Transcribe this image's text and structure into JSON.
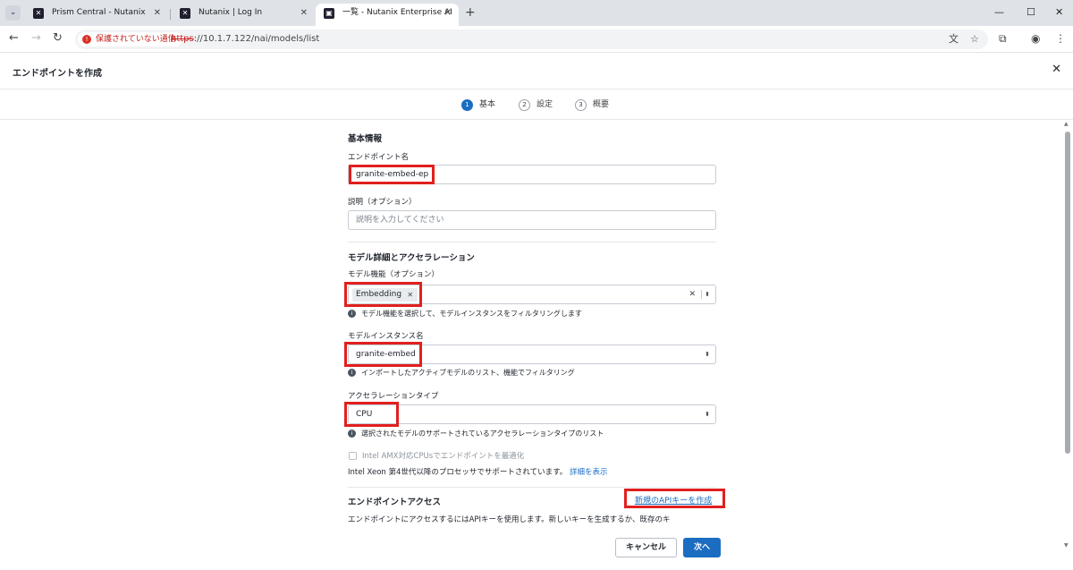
{
  "browser": {
    "tabs": [
      {
        "title": "Prism Central - Nutanix",
        "active": false
      },
      {
        "title": "Nutanix | Log In",
        "active": false
      },
      {
        "title": "一覧 - Nutanix Enterprise AI",
        "active": true
      }
    ],
    "security_chip": "保護されていない通信",
    "url_scheme": "https",
    "url_rest": "://10.1.7.122/nai/models/list"
  },
  "page": {
    "title": "エンドポイントを作成",
    "steps": [
      {
        "num": "1",
        "label": "基本"
      },
      {
        "num": "2",
        "label": "設定"
      },
      {
        "num": "3",
        "label": "概要"
      }
    ]
  },
  "form": {
    "basic_title": "基本情報",
    "endpoint_name_label": "エンドポイント名",
    "endpoint_name_value": "granite-embed-ep",
    "description_label": "説明（オプション）",
    "description_placeholder": "説明を入力してください",
    "model_section_title": "モデル詳細とアクセラレーション",
    "capability_label": "モデル機能（オプション）",
    "capability_tag": "Embedding",
    "capability_help": "モデル機能を選択して、モデルインスタンスをフィルタリングします",
    "instance_label": "モデルインスタンス名",
    "instance_value": "granite-embed",
    "instance_help": "インポートしたアクティブモデルのリスト、機能でフィルタリング",
    "accel_label": "アクセラレーションタイプ",
    "accel_value": "CPU",
    "accel_help": "選択されたモデルのサポートされているアクセラレーションタイプのリスト",
    "amx_label": "Intel AMX対応CPUsでエンドポイントを最適化",
    "xeon_note": "Intel Xeon 第4世代以降のプロセッサでサポートされています。",
    "details_link": "詳細を表示",
    "access_title": "エンドポイントアクセス",
    "new_api_key": "新規のAPIキーを作成",
    "access_desc": "エンドポイントにアクセスするにはAPIキーを使用します。新しいキーを生成するか、既存のキ"
  },
  "footer": {
    "cancel": "キャンセル",
    "next": "次へ"
  },
  "colors": {
    "accent": "#1b6dc1",
    "highlight": "#e11f1f"
  }
}
